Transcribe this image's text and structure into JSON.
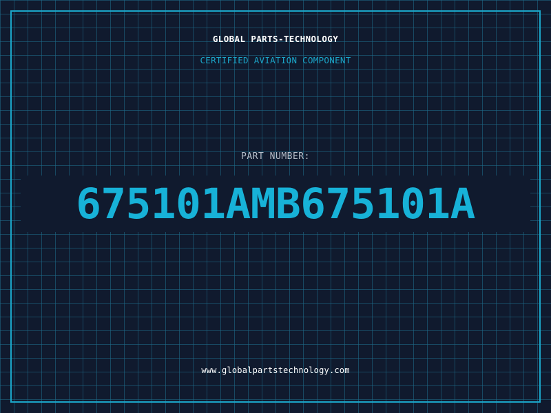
{
  "header": {
    "company": "GLOBAL PARTS-TECHNOLOGY",
    "subtitle": "CERTIFIED AVIATION COMPONENT"
  },
  "part": {
    "label": "PART NUMBER:",
    "number": "675101AMB675101A"
  },
  "footer": {
    "url": "www.globalpartstechnology.com"
  },
  "colors": {
    "background": "#101a2e",
    "accent": "#1ba6c9",
    "grid": "#1e6e8c",
    "text_primary": "#ffffff",
    "text_muted": "#b7bfca"
  }
}
